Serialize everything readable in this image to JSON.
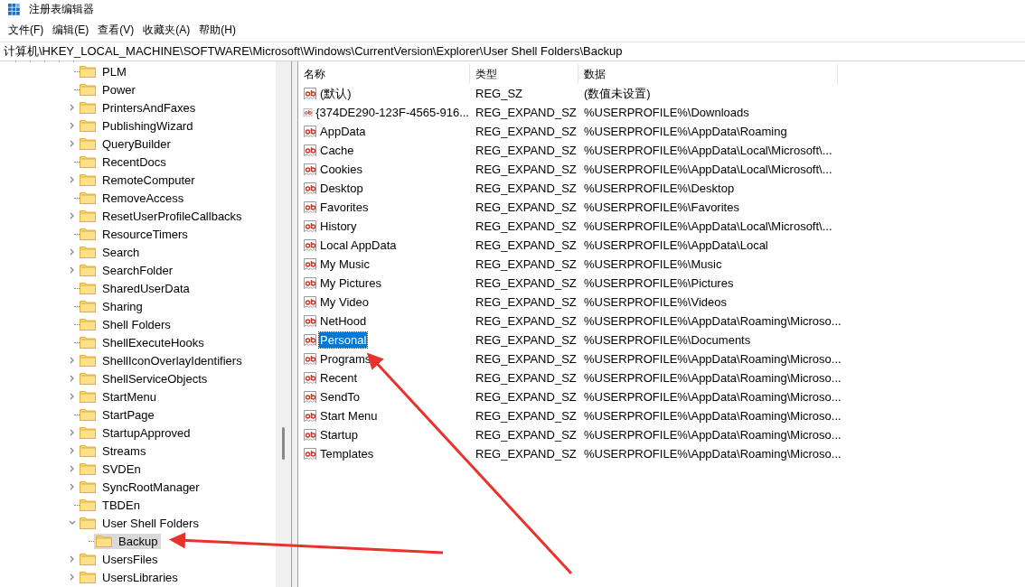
{
  "window": {
    "title": "注册表编辑器"
  },
  "menu": [
    "文件(F)",
    "编辑(E)",
    "查看(V)",
    "收藏夹(A)",
    "帮助(H)"
  ],
  "address": "计算机\\HKEY_LOCAL_MACHINE\\SOFTWARE\\Microsoft\\Windows\\CurrentVersion\\Explorer\\User Shell Folders\\Backup",
  "tree": [
    {
      "label": "PLM",
      "expandable": false,
      "selected": false
    },
    {
      "label": "Power",
      "expandable": false,
      "selected": false
    },
    {
      "label": "PrintersAndFaxes",
      "expandable": true,
      "selected": false
    },
    {
      "label": "PublishingWizard",
      "expandable": true,
      "selected": false
    },
    {
      "label": "QueryBuilder",
      "expandable": true,
      "selected": false
    },
    {
      "label": "RecentDocs",
      "expandable": false,
      "selected": false
    },
    {
      "label": "RemoteComputer",
      "expandable": true,
      "selected": false
    },
    {
      "label": "RemoveAccess",
      "expandable": false,
      "selected": false
    },
    {
      "label": "ResetUserProfileCallbacks",
      "expandable": true,
      "selected": false
    },
    {
      "label": "ResourceTimers",
      "expandable": false,
      "selected": false
    },
    {
      "label": "Search",
      "expandable": true,
      "selected": false
    },
    {
      "label": "SearchFolder",
      "expandable": true,
      "selected": false
    },
    {
      "label": "SharedUserData",
      "expandable": false,
      "selected": false
    },
    {
      "label": "Sharing",
      "expandable": false,
      "selected": false
    },
    {
      "label": "Shell Folders",
      "expandable": false,
      "selected": false
    },
    {
      "label": "ShellExecuteHooks",
      "expandable": false,
      "selected": false
    },
    {
      "label": "ShellIconOverlayIdentifiers",
      "expandable": true,
      "selected": false
    },
    {
      "label": "ShellServiceObjects",
      "expandable": true,
      "selected": false
    },
    {
      "label": "StartMenu",
      "expandable": true,
      "selected": false
    },
    {
      "label": "StartPage",
      "expandable": false,
      "selected": false
    },
    {
      "label": "StartupApproved",
      "expandable": true,
      "selected": false
    },
    {
      "label": "Streams",
      "expandable": true,
      "selected": false
    },
    {
      "label": "SVDEn",
      "expandable": true,
      "selected": false
    },
    {
      "label": "SyncRootManager",
      "expandable": true,
      "selected": false
    },
    {
      "label": "TBDEn",
      "expandable": false,
      "selected": false
    },
    {
      "label": "User Shell Folders",
      "expandable": true,
      "expanded": true,
      "selected": false,
      "children": [
        {
          "label": "Backup",
          "expandable": false,
          "selected": true
        }
      ]
    },
    {
      "label": "UsersFiles",
      "expandable": true,
      "selected": false
    },
    {
      "label": "UsersLibraries",
      "expandable": true,
      "selected": false
    }
  ],
  "list": {
    "columns": [
      "名称",
      "类型",
      "数据"
    ],
    "rows": [
      {
        "name": "(默认)",
        "type": "REG_SZ",
        "data": "(数值未设置)",
        "selected": false
      },
      {
        "name": "{374DE290-123F-4565-916...",
        "type": "REG_EXPAND_SZ",
        "data": "%USERPROFILE%\\Downloads",
        "selected": false
      },
      {
        "name": "AppData",
        "type": "REG_EXPAND_SZ",
        "data": "%USERPROFILE%\\AppData\\Roaming",
        "selected": false
      },
      {
        "name": "Cache",
        "type": "REG_EXPAND_SZ",
        "data": "%USERPROFILE%\\AppData\\Local\\Microsoft\\...",
        "selected": false
      },
      {
        "name": "Cookies",
        "type": "REG_EXPAND_SZ",
        "data": "%USERPROFILE%\\AppData\\Local\\Microsoft\\...",
        "selected": false
      },
      {
        "name": "Desktop",
        "type": "REG_EXPAND_SZ",
        "data": "%USERPROFILE%\\Desktop",
        "selected": false
      },
      {
        "name": "Favorites",
        "type": "REG_EXPAND_SZ",
        "data": "%USERPROFILE%\\Favorites",
        "selected": false
      },
      {
        "name": "History",
        "type": "REG_EXPAND_SZ",
        "data": "%USERPROFILE%\\AppData\\Local\\Microsoft\\...",
        "selected": false
      },
      {
        "name": "Local AppData",
        "type": "REG_EXPAND_SZ",
        "data": "%USERPROFILE%\\AppData\\Local",
        "selected": false
      },
      {
        "name": "My Music",
        "type": "REG_EXPAND_SZ",
        "data": "%USERPROFILE%\\Music",
        "selected": false
      },
      {
        "name": "My Pictures",
        "type": "REG_EXPAND_SZ",
        "data": "%USERPROFILE%\\Pictures",
        "selected": false
      },
      {
        "name": "My Video",
        "type": "REG_EXPAND_SZ",
        "data": "%USERPROFILE%\\Videos",
        "selected": false
      },
      {
        "name": "NetHood",
        "type": "REG_EXPAND_SZ",
        "data": "%USERPROFILE%\\AppData\\Roaming\\Microso...",
        "selected": false
      },
      {
        "name": "Personal",
        "type": "REG_EXPAND_SZ",
        "data": "%USERPROFILE%\\Documents",
        "selected": true
      },
      {
        "name": "Programs",
        "type": "REG_EXPAND_SZ",
        "data": "%USERPROFILE%\\AppData\\Roaming\\Microso...",
        "selected": false
      },
      {
        "name": "Recent",
        "type": "REG_EXPAND_SZ",
        "data": "%USERPROFILE%\\AppData\\Roaming\\Microso...",
        "selected": false
      },
      {
        "name": "SendTo",
        "type": "REG_EXPAND_SZ",
        "data": "%USERPROFILE%\\AppData\\Roaming\\Microso...",
        "selected": false
      },
      {
        "name": "Start Menu",
        "type": "REG_EXPAND_SZ",
        "data": "%USERPROFILE%\\AppData\\Roaming\\Microso...",
        "selected": false
      },
      {
        "name": "Startup",
        "type": "REG_EXPAND_SZ",
        "data": "%USERPROFILE%\\AppData\\Roaming\\Microso...",
        "selected": false
      },
      {
        "name": "Templates",
        "type": "REG_EXPAND_SZ",
        "data": "%USERPROFILE%\\AppData\\Roaming\\Microso...",
        "selected": false
      }
    ]
  }
}
